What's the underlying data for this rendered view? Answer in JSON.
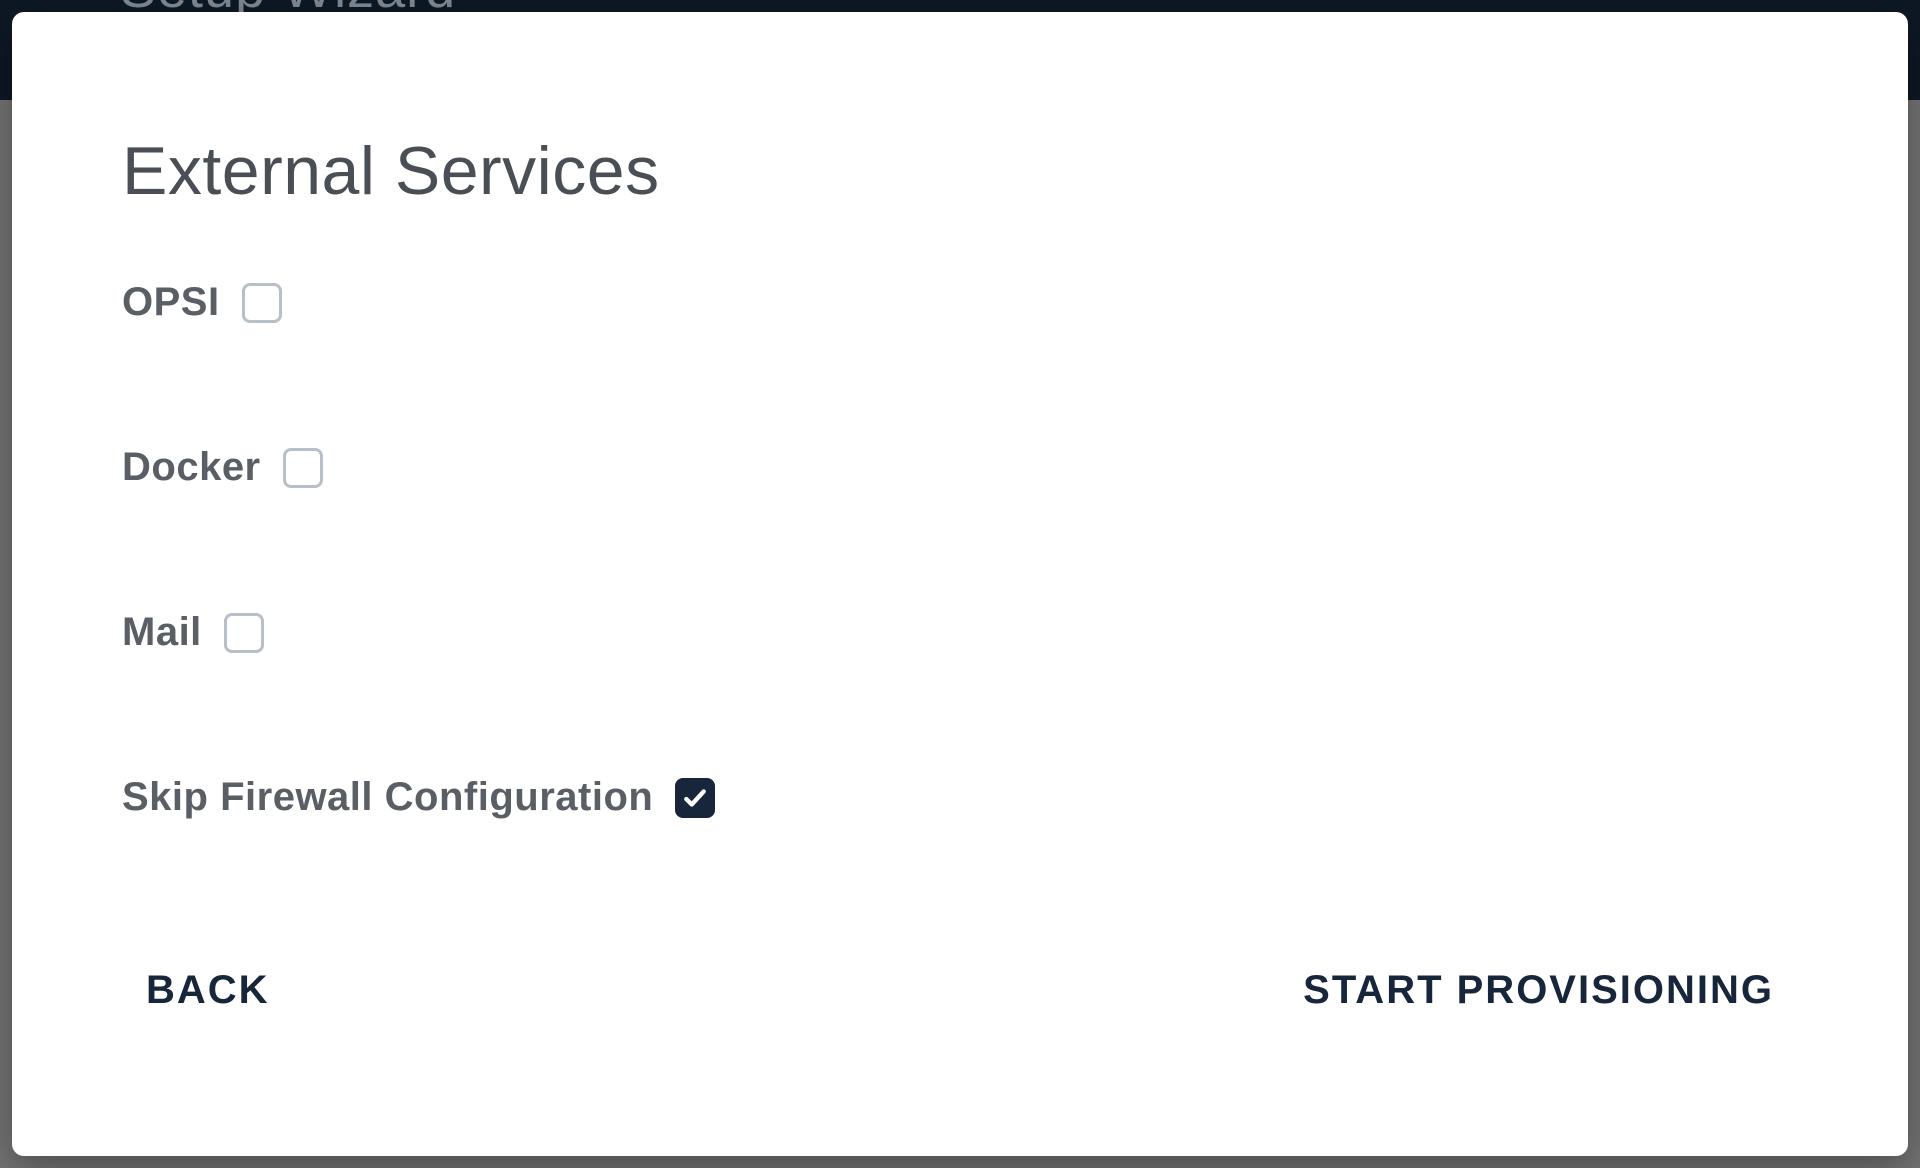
{
  "background": {
    "window_title": "Setup Wizard"
  },
  "modal": {
    "title": "External Services",
    "options": [
      {
        "label": "OPSI",
        "checked": false
      },
      {
        "label": "Docker",
        "checked": false
      },
      {
        "label": "Mail",
        "checked": false
      },
      {
        "label": "Skip Firewall Configuration",
        "checked": true
      }
    ],
    "buttons": {
      "back": "BACK",
      "primary": "START PROVISIONING"
    }
  }
}
